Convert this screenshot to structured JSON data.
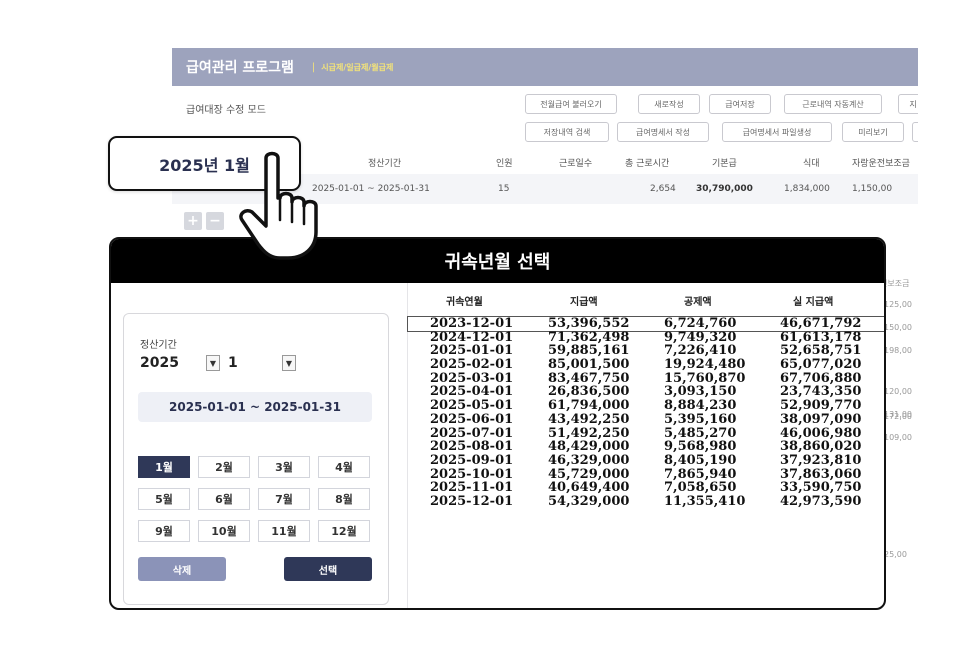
{
  "app": {
    "title": "급여관리 프로그램",
    "title_sep": "|",
    "subtitle": "시급제/일급제/월급제",
    "mode_label": "급여대장 수정 모드",
    "toolbar_row1": [
      "전월급여 불러오기",
      "새로작성",
      "급여저장",
      "근로내역 자동계산",
      "지"
    ],
    "toolbar_row2": [
      "저장내역 검색",
      "급여명세서 작성",
      "급여명세서 파일생성",
      "미리보기",
      ""
    ],
    "period_headers": [
      "정산기간",
      "인원",
      "근로일수",
      "총 근로시간",
      "기본급",
      "식대",
      "자랑운전보조금"
    ],
    "period_row": {
      "range": "2025-01-01 ~ 2025-01-31",
      "count": "15",
      "total_hours": "2,654",
      "base_pay": "30,790,000",
      "meals": "1,834,000",
      "allowance": "1,150,00"
    },
    "add_btn": "+",
    "remove_btn": "−",
    "right_strip_header": "전보조금",
    "right_strip_values": [
      "125,00",
      "150,00",
      "198,00",
      "172,00",
      "120,00",
      "131,00",
      "109,00",
      "25,00"
    ]
  },
  "badge": {
    "label": "2025년 1월"
  },
  "modal": {
    "title": "귀속년월 선택",
    "period_label": "정산기간",
    "year": "2025",
    "month": "1",
    "range": "2025-01-01 ~ 2025-01-31",
    "months": [
      "1월",
      "2월",
      "3월",
      "4월",
      "5월",
      "6월",
      "7월",
      "8월",
      "9월",
      "10월",
      "11월",
      "12월"
    ],
    "active_month_index": 0,
    "delete_label": "삭제",
    "select_label": "선택",
    "columns": [
      "귀속연월",
      "지급액",
      "공제액",
      "실 지급액"
    ],
    "rows": [
      [
        "2023-12-01",
        "53,396,552",
        "6,724,760",
        "46,671,792"
      ],
      [
        "2024-12-01",
        "71,362,498",
        "9,749,320",
        "61,613,178"
      ],
      [
        "2025-01-01",
        "59,885,161",
        "7,226,410",
        "52,658,751"
      ],
      [
        "2025-02-01",
        "85,001,500",
        "19,924,480",
        "65,077,020"
      ],
      [
        "2025-03-01",
        "83,467,750",
        "15,760,870",
        "67,706,880"
      ],
      [
        "2025-04-01",
        "26,836,500",
        "3,093,150",
        "23,743,350"
      ],
      [
        "2025-05-01",
        "61,794,000",
        "8,884,230",
        "52,909,770"
      ],
      [
        "2025-06-01",
        "43,492,250",
        "5,395,160",
        "38,097,090"
      ],
      [
        "2025-07-01",
        "51,492,250",
        "5,485,270",
        "46,006,980"
      ],
      [
        "2025-08-01",
        "48,429,000",
        "9,568,980",
        "38,860,020"
      ],
      [
        "2025-09-01",
        "46,329,000",
        "8,405,190",
        "37,923,810"
      ],
      [
        "2025-10-01",
        "45,729,000",
        "7,865,940",
        "37,863,060"
      ],
      [
        "2025-11-01",
        "40,649,400",
        "7,058,650",
        "33,590,750"
      ],
      [
        "2025-12-01",
        "54,329,000",
        "11,355,410",
        "42,973,590"
      ]
    ],
    "selected_row_index": 0
  },
  "colors": {
    "titlebar": "#9da3bd",
    "accent_dark": "#2f3858",
    "accent_light": "#8b93b8",
    "subtitle": "#f2e27a"
  },
  "icons": {
    "cursor": "pointing-hand-icon",
    "dropdown": "triangle-down-icon"
  }
}
